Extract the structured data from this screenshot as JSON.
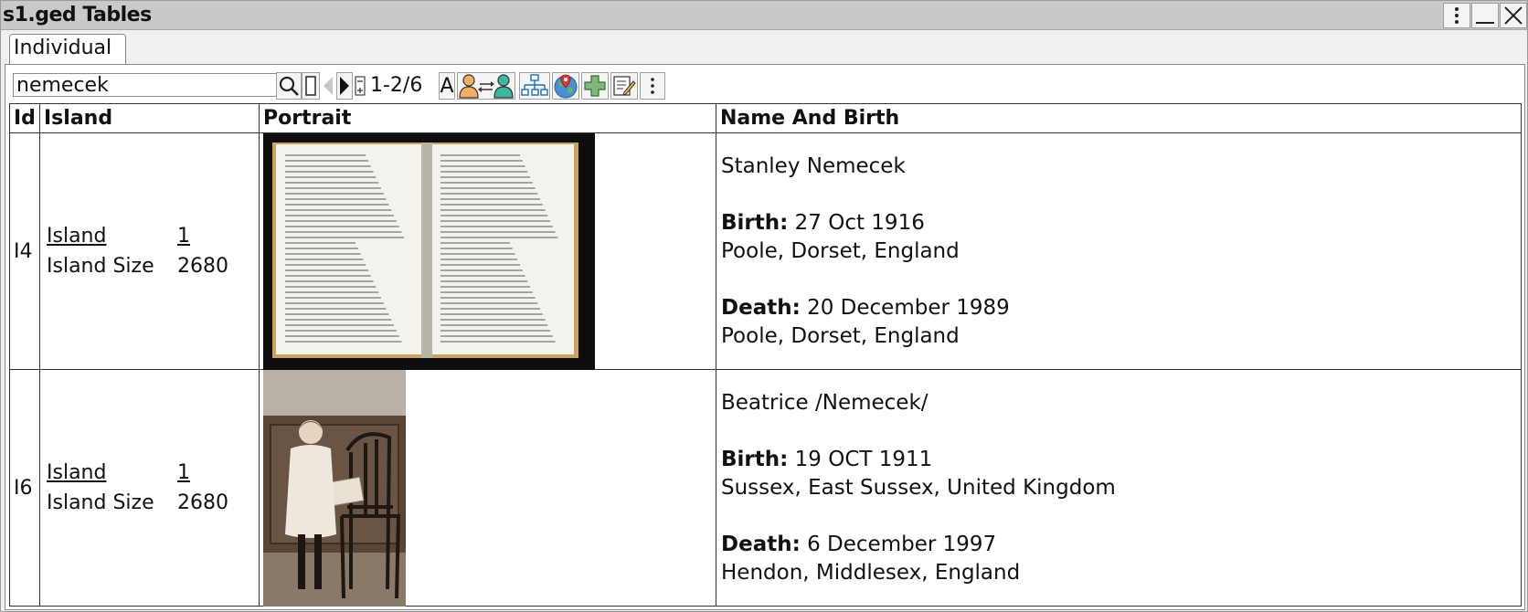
{
  "window": {
    "title": "s1.ged Tables",
    "buttons": [
      "kebab-menu-icon",
      "minimize-icon",
      "close-icon"
    ]
  },
  "tabs": [
    {
      "label": "Individual",
      "active": true
    }
  ],
  "toolbar": {
    "search_value": "nemecek",
    "counter": "1-2/6",
    "font_button_label": "A",
    "icons": [
      "search-icon",
      "select-mode-icon",
      "previous-icon",
      "next-icon",
      "row-size-icon",
      "font-icon",
      "swap-persons-icon",
      "tree-icon",
      "map-icon",
      "add-icon",
      "edit-icon",
      "more-icon"
    ]
  },
  "table": {
    "columns": [
      "Id",
      "Island",
      "Portrait",
      "Name And Birth"
    ],
    "rows": [
      {
        "id": "I4",
        "island_label": "Island",
        "island_value": "1",
        "island_size_label": "Island Size",
        "island_size_value": "2680",
        "portrait": "open-book-photo",
        "name": "Stanley Nemecek",
        "birth_label": "Birth:",
        "birth_date": "27 Oct 1916",
        "birth_place": "Poole, Dorset, England",
        "death_label": "Death:",
        "death_date": "20 December 1989",
        "death_place": "Poole, Dorset, England"
      },
      {
        "id": "I6",
        "island_label": "Island",
        "island_value": "1",
        "island_size_label": "Island Size",
        "island_size_value": "2680",
        "portrait": "girl-with-chair-photo",
        "name": "Beatrice /Nemecek/",
        "birth_label": "Birth:",
        "birth_date": "19 OCT 1911",
        "birth_place": "Sussex, East Sussex, United Kingdom",
        "death_label": "Death:",
        "death_date": "6 December 1997",
        "death_place": "Hendon, Middlesex, England"
      }
    ]
  },
  "colors": {
    "titlebar": "#c9c9c9",
    "window_bg": "#f2f0ef",
    "icon_person_orange": "#f0b060",
    "icon_person_teal": "#3cb8a0",
    "icon_tree_blue": "#1a6fc0",
    "icon_add_green": "#7fb87a"
  }
}
